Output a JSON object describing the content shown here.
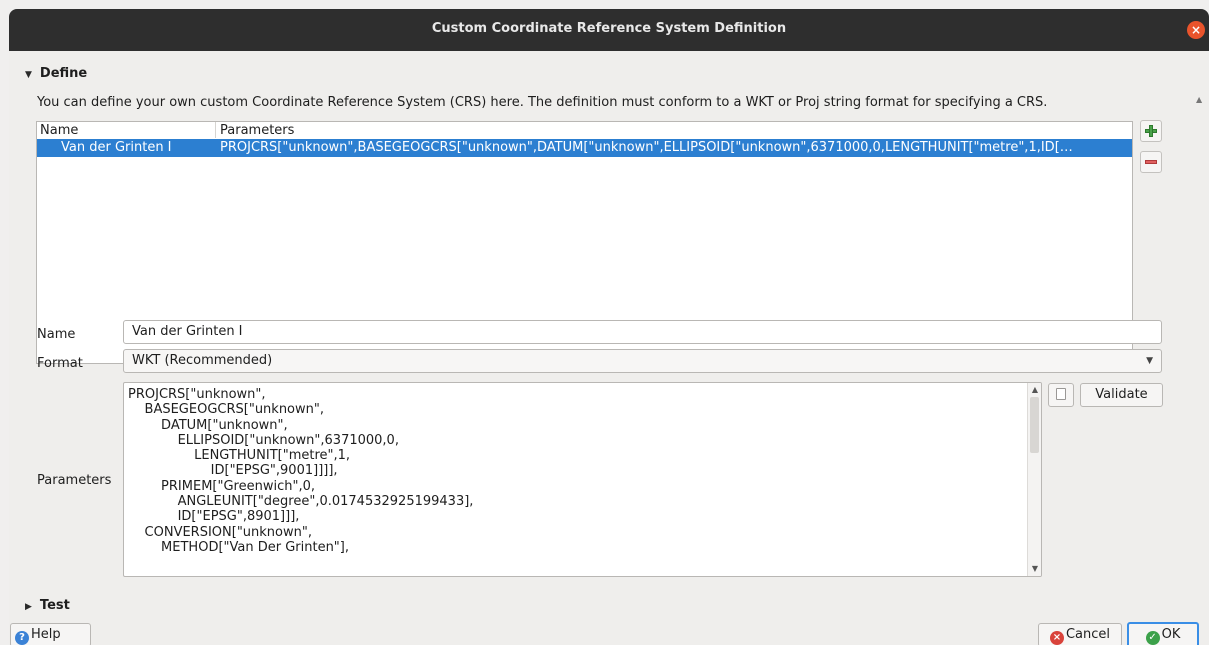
{
  "window": {
    "title": "Custom Coordinate Reference System Definition"
  },
  "define": {
    "header": "Define",
    "intro": "You can define your own custom Coordinate Reference System (CRS) here. The definition must conform to a WKT or Proj string format for specifying a CRS.",
    "table": {
      "columns": [
        "Name",
        "Parameters"
      ],
      "rows": [
        {
          "name": "Van der Grinten I",
          "parameters": "PROJCRS[\"unknown\",BASEGEOGCRS[\"unknown\",DATUM[\"unknown\",ELLIPSOID[\"unknown\",6371000,0,LENGTHUNIT[\"metre\",1,ID[…"
        }
      ]
    },
    "name_label": "Name",
    "name_value": "Van der Grinten I",
    "format_label": "Format",
    "format_value": "WKT (Recommended)",
    "parameters_label": "Parameters",
    "parameters_text": "PROJCRS[\"unknown\",\n    BASEGEOGCRS[\"unknown\",\n        DATUM[\"unknown\",\n            ELLIPSOID[\"unknown\",6371000,0,\n                LENGTHUNIT[\"metre\",1,\n                    ID[\"EPSG\",9001]]]],\n        PRIMEM[\"Greenwich\",0,\n            ANGLEUNIT[\"degree\",0.0174532925199433],\n            ID[\"EPSG\",8901]]],\n    CONVERSION[\"unknown\",\n        METHOD[\"Van Der Grinten\"],",
    "validate_label": "Validate"
  },
  "test": {
    "header": "Test"
  },
  "footer": {
    "help_label": "Help",
    "cancel_label": "Cancel",
    "ok_label": "OK"
  },
  "icons": {
    "add": "plus-icon",
    "remove": "minus-icon",
    "copy": "copy-icon",
    "close": "close-icon",
    "help": "help-icon",
    "cancel": "cancel-icon",
    "ok": "ok-icon"
  },
  "colors": {
    "selection": "#2c7fd1",
    "titlebar": "#2e2e2e",
    "close": "#e9542c"
  }
}
